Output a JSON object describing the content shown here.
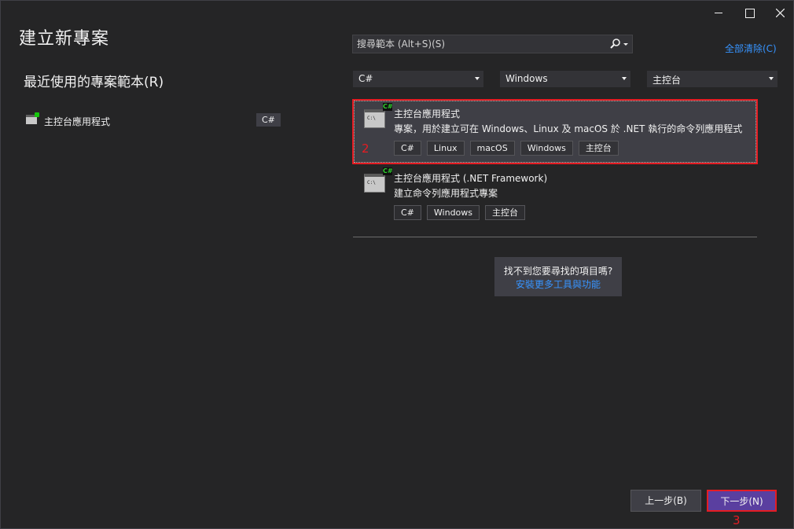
{
  "window": {
    "title": "建立新專案"
  },
  "recent": {
    "heading": "最近使用的專案範本(R)",
    "items": [
      {
        "label": "主控台應用程式",
        "tag": "C#",
        "icon": "console-app-icon"
      }
    ]
  },
  "search": {
    "placeholder": "搜尋範本 (Alt+S)(S)",
    "icon": "search-icon"
  },
  "clear_all": "全部清除(C)",
  "filters": {
    "language": "C#",
    "platform": "Windows",
    "project_type": "主控台"
  },
  "templates": [
    {
      "name": "主控台應用程式",
      "description": "專案，用於建立可在 Windows、Linux 及 macOS 於 .NET 執行的命令列應用程式",
      "tags": [
        "C#",
        "Linux",
        "macOS",
        "Windows",
        "主控台"
      ],
      "selected": true,
      "icon": "console-app-icon"
    },
    {
      "name": "主控台應用程式 (.NET Framework)",
      "description": "建立命令列應用程式專案",
      "tags": [
        "C#",
        "Windows",
        "主控台"
      ],
      "selected": false,
      "icon": "console-app-icon"
    }
  ],
  "icon_texts": {
    "badge": "C#",
    "prompt": "C:\\"
  },
  "not_found": {
    "question": "找不到您要尋找的項目嗎?",
    "link": "安裝更多工具與功能"
  },
  "buttons": {
    "back": "上一步(B)",
    "next": "下一步(N)"
  },
  "annotations": {
    "marker_2": "2",
    "marker_3": "3"
  },
  "colors": {
    "background": "#252526",
    "accent": "#5a3fa0",
    "link": "#3794ff",
    "highlight_border": "#e51c23"
  }
}
